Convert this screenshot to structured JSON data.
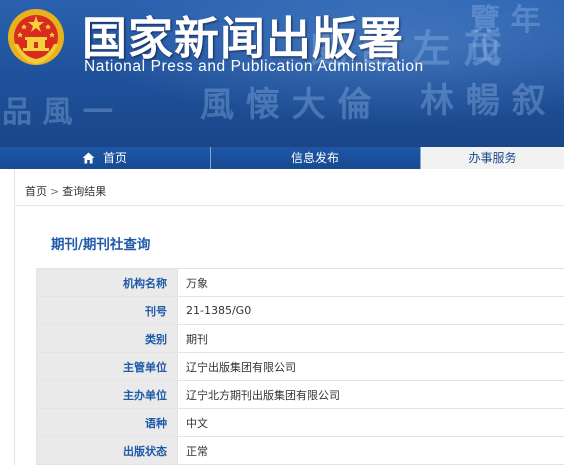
{
  "header": {
    "title_cn": "国家新闻出版署",
    "title_en": "National Press and Publication Administration",
    "emblem_icon": "national-emblem-icon"
  },
  "nav": {
    "items": [
      {
        "label": "首页",
        "icon": "home-icon"
      },
      {
        "label": "信息发布"
      },
      {
        "label": "办事服务"
      }
    ]
  },
  "breadcrumb": {
    "home": "首页",
    "separator": ">",
    "current": "查询结果"
  },
  "page": {
    "heading": "期刊/期刊社查询"
  },
  "details": {
    "rows": [
      {
        "label": "机构名称",
        "value": "万象"
      },
      {
        "label": "刊号",
        "value": "21-1385/G0"
      },
      {
        "label": "类别",
        "value": "期刊"
      },
      {
        "label": "主管单位",
        "value": "辽宁出版集团有限公司"
      },
      {
        "label": "主办单位",
        "value": "辽宁北方期刊出版集团有限公司"
      },
      {
        "label": "语种",
        "value": "中文"
      },
      {
        "label": "出版状态",
        "value": "正常"
      }
    ]
  },
  "colors": {
    "banner_blue": "#1e4f98",
    "nav_blue": "#1a50a0",
    "label_blue": "#1f5aa8",
    "label_bg": "#eaeaea"
  }
}
